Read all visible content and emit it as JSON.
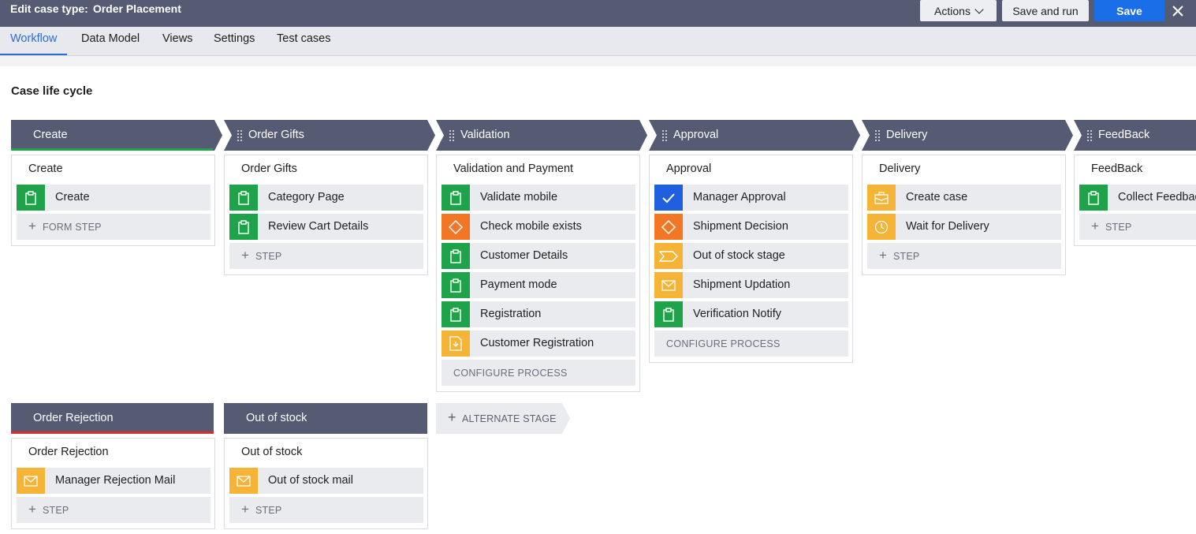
{
  "header": {
    "title_prefix": "Edit case type:",
    "case_type_name": "Order Placement",
    "actions_label": "Actions",
    "save_and_run_label": "Save and run",
    "save_label": "Save"
  },
  "tabs": [
    {
      "label": "Workflow",
      "active": true
    },
    {
      "label": "Data Model"
    },
    {
      "label": "Views"
    },
    {
      "label": "Settings"
    },
    {
      "label": "Test cases"
    }
  ],
  "section_title": "Case life cycle",
  "stages": [
    {
      "name": "Create",
      "process": "Create",
      "steps": [
        {
          "label": "Create",
          "icon": "clipboard-icon",
          "color": "#1fa34a"
        }
      ],
      "add_label": "FORM STEP"
    },
    {
      "name": "Order Gifts",
      "process": "Order Gifts",
      "steps": [
        {
          "label": "Category Page",
          "icon": "clipboard-icon",
          "color": "#1fa34a"
        },
        {
          "label": "Review Cart Details",
          "icon": "clipboard-icon",
          "color": "#1fa34a"
        }
      ],
      "add_label": "STEP"
    },
    {
      "name": "Validation",
      "process": "Validation and Payment",
      "steps": [
        {
          "label": "Validate mobile",
          "icon": "clipboard-icon",
          "color": "#1fa34a"
        },
        {
          "label": "Check mobile exists",
          "icon": "decision-diamond-icon",
          "color": "#f27623"
        },
        {
          "label": "Customer Details",
          "icon": "clipboard-icon",
          "color": "#1fa34a"
        },
        {
          "label": "Payment mode",
          "icon": "clipboard-icon",
          "color": "#1fa34a"
        },
        {
          "label": "Registration",
          "icon": "clipboard-icon",
          "color": "#1fa34a"
        },
        {
          "label": "Customer Registration",
          "icon": "file-download-icon",
          "color": "#f6b437"
        }
      ],
      "configure_label": "CONFIGURE PROCESS"
    },
    {
      "name": "Approval",
      "process": "Approval",
      "steps": [
        {
          "label": "Manager Approval",
          "icon": "check-icon",
          "color": "#1f5fe0"
        },
        {
          "label": "Shipment Decision",
          "icon": "decision-diamond-icon",
          "color": "#f27623"
        },
        {
          "label": "Out of stock stage",
          "icon": "change-stage-icon",
          "color": "#f6b437"
        },
        {
          "label": "Shipment Updation",
          "icon": "mail-icon",
          "color": "#f6b437"
        },
        {
          "label": "Verification Notify",
          "icon": "clipboard-icon",
          "color": "#1fa34a"
        }
      ],
      "configure_label": "CONFIGURE PROCESS"
    },
    {
      "name": "Delivery",
      "process": "Delivery",
      "steps": [
        {
          "label": "Create case",
          "icon": "create-case-icon",
          "color": "#f6b437"
        },
        {
          "label": "Wait for Delivery",
          "icon": "clock-icon",
          "color": "#f6b437"
        }
      ],
      "add_label": "STEP"
    },
    {
      "name": "FeedBack",
      "process": "FeedBack",
      "steps": [
        {
          "label": "Collect Feedback",
          "icon": "clipboard-icon",
          "color": "#1fa34a"
        }
      ],
      "add_label": "STEP"
    }
  ],
  "alternate_stages": [
    {
      "name": "Order Rejection",
      "process": "Order Rejection",
      "steps": [
        {
          "label": "Manager Rejection Mail",
          "icon": "mail-icon",
          "color": "#f6b437"
        }
      ],
      "add_label": "STEP"
    },
    {
      "name": "Out of stock",
      "process": "Out of stock",
      "steps": [
        {
          "label": "Out of stock mail",
          "icon": "mail-icon",
          "color": "#f6b437"
        }
      ],
      "add_label": "STEP"
    }
  ],
  "alternate_stage_button_label": "ALTERNATE STAGE",
  "colors": {
    "header_bg": "#545b72",
    "stage_bg": "#545b72",
    "accent_blue": "#1a6fe8",
    "primary_underline": "#1fa34a",
    "alternate_underline": "#d92f2f"
  }
}
